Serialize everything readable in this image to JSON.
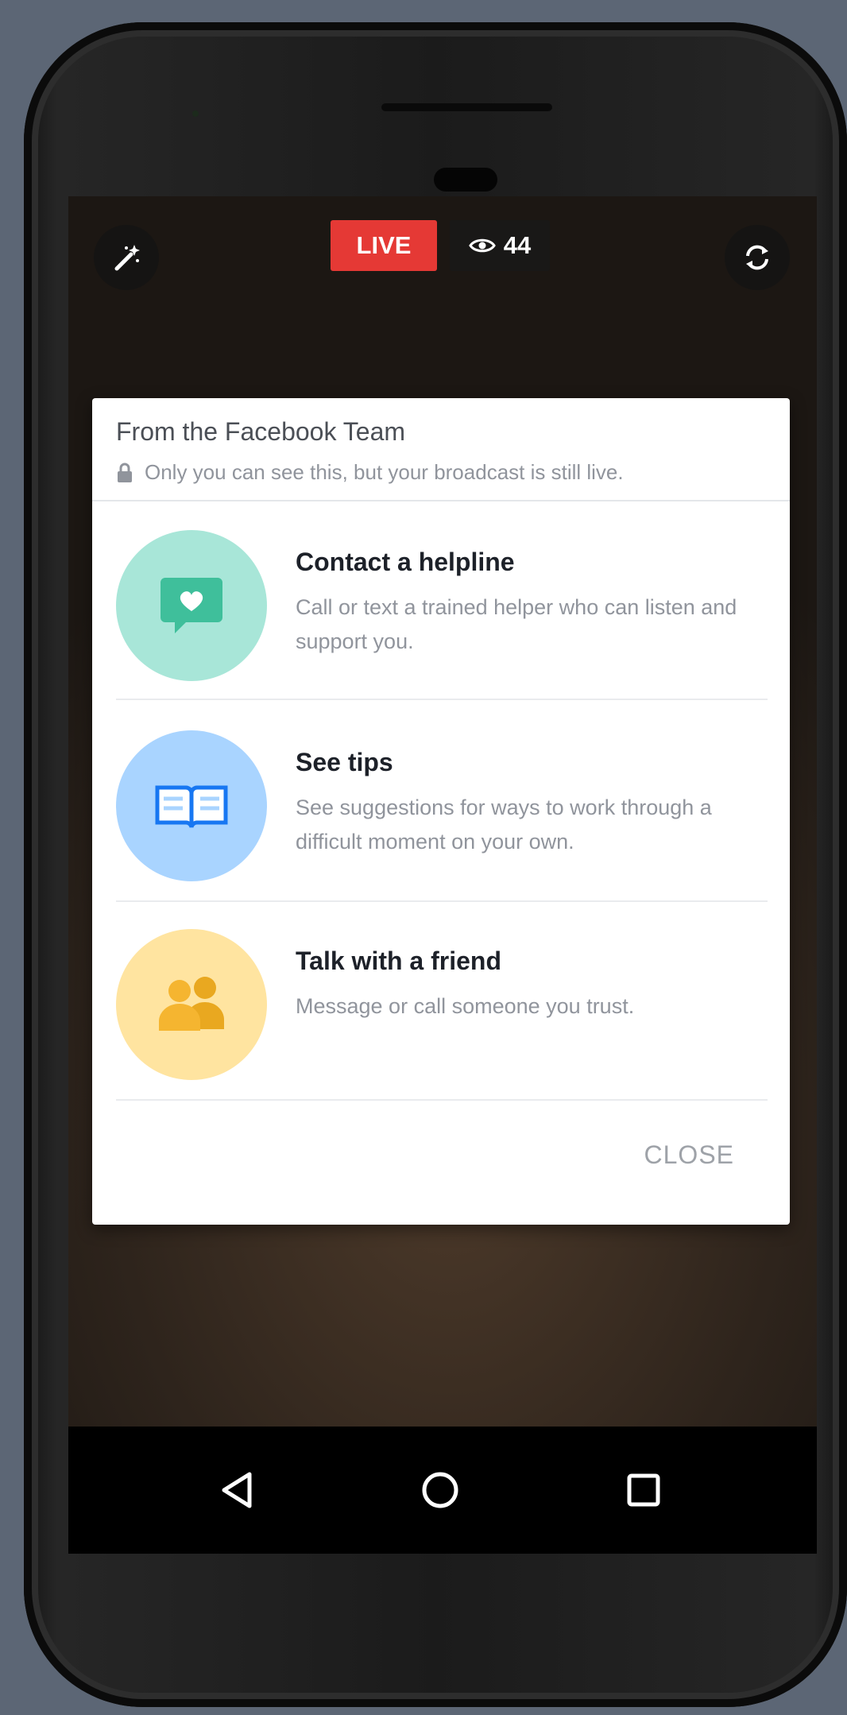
{
  "live": {
    "badge": "LIVE",
    "viewer_count": "44"
  },
  "dialog": {
    "title": "From the Facebook Team",
    "subtitle": "Only you can see this, but your broadcast is still live.",
    "options": [
      {
        "title": "Contact a helpline",
        "description": "Call or text a trained helper who can listen and support you.",
        "icon": "chat-heart-icon",
        "color": "#a8e6d8",
        "icon_color": "#3fbf9b"
      },
      {
        "title": "See tips",
        "description": "See suggestions for ways to work through a difficult moment on your own.",
        "icon": "open-book-icon",
        "color": "#a9d4ff",
        "icon_color": "#1877f2"
      },
      {
        "title": "Talk with a friend",
        "description": "Message or call someone you trust.",
        "icon": "people-icon",
        "color": "#ffe4a0",
        "icon_color": "#f5b530"
      }
    ],
    "close_label": "CLOSE"
  },
  "icons": {
    "magic_wand": "magic-wand-icon",
    "switch_camera": "switch-camera-icon",
    "eye": "eye-icon",
    "lock": "lock-icon",
    "nav_back": "back-triangle-icon",
    "nav_home": "home-circle-icon",
    "nav_recents": "recents-square-icon"
  }
}
